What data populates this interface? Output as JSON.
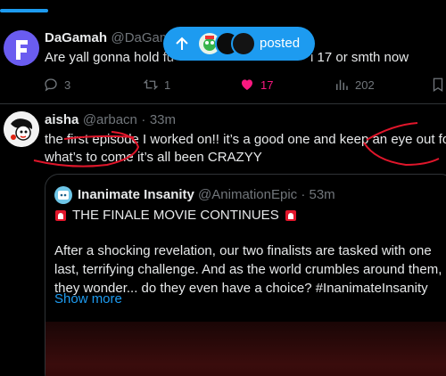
{
  "tweet1": {
    "name": "DaGamah",
    "handle": "@DaGama",
    "text_left": "Are yall gonna hold fu",
    "text_right": "i 17 or smth now",
    "replies": "3",
    "retweets": "1",
    "likes": "17",
    "views": "202"
  },
  "posted_pill": {
    "label": "posted"
  },
  "tweet2": {
    "name": "aisha",
    "handle": "@arbacn",
    "time": "33m",
    "text_line1": "the first episode I worked on!! it’s a good one and keep an eye out for",
    "text_line2": "what’s to come it’s all been CRAZYY"
  },
  "quote": {
    "name": "Inanimate Insanity",
    "handle": "@AnimationEpic",
    "time": "53m",
    "title": "THE FINALE MOVIE CONTINUES",
    "text": "After a shocking revelation, our two finalists are tasked with one last, terrifying challenge. And as the world crumbles around them, they wonder... do they even have a choice? #InanimateInsanity",
    "show_more": "Show more"
  },
  "colors": {
    "accent": "#1d9bf0",
    "like": "#f91880",
    "annotation": "#e0162b"
  }
}
